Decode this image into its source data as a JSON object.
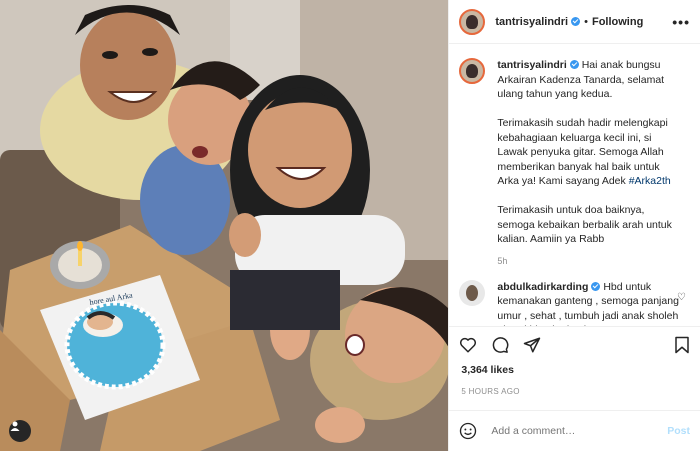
{
  "post": {
    "username": "tantrisyalindri",
    "follow_label": "Following",
    "more_label": "•••",
    "caption": {
      "p1": "Hai anak bungsu Arkairan Kadenza Tanarda, selamat ulang tahun yang kedua.",
      "p2_before": "Terimakasih sudah hadir melengkapi kebahagiaan keluarga kecil ini, si Lawak penyuka gitar. Semoga Allah memberikan banyak hal baik untuk Arka ya! Kami sayang Adek ",
      "p2_tag": "#Arka2th",
      "p3": "Terimakasih untuk doa baiknya, semoga kebaikan berbalik arah untuk kalian. Aamiin ya Rabb",
      "age": "5h"
    },
    "comment": {
      "username": "abdulkadirkarding",
      "text": "Hbd untuk kemanakan ganteng , semoga panjang umur , sehat , tumbuh jadi anak sholeh , berakhlaq karimah"
    },
    "likes": "3,364 likes",
    "time": "5 HOURS AGO",
    "add_comment_placeholder": "Add a comment…",
    "post_label": "Post",
    "cake_text": "hore aul Arka"
  },
  "colors": {
    "accent": "#3897f0",
    "post_btn": "#b2dffc",
    "tag": "#00376b"
  }
}
